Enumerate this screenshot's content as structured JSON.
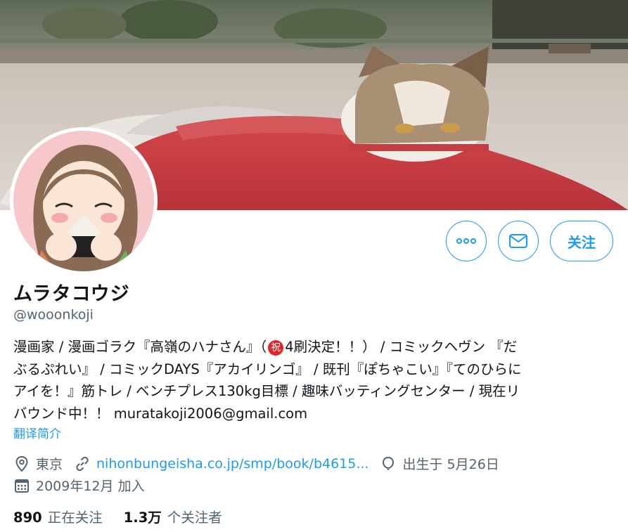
{
  "profile": {
    "name": "ムラタコウジ",
    "handle": "@wooonkoji",
    "bio_lines": [
      "漫画家 / 漫画ゴラク『高嶺のハナさん』（",
      "4刷決定！！） / コミックヘヴン 『だ",
      "ぶるぷれい』 / コミックDAYS『アカイリンゴ』 / 既刊『ぽちゃこい』『てのひらに",
      "アイを！』筋トレ / ベンチプレス130kg目標 / 趣味バッティングセンター / 現在リ",
      "バウンド中！！ muratakoji2006@gmail.com"
    ],
    "bio_emoji": "祝",
    "translate_label": "翻译简介",
    "location": "東京",
    "website": "nihonbungeisha.co.jp/smp/book/b4615...",
    "birthday": "出生于 5月26日",
    "joined": "2009年12月 加入"
  },
  "actions": {
    "more_icon": "more-icon",
    "message_icon": "mail-icon",
    "follow_label": "关注"
  },
  "stats": {
    "following_count": "890",
    "following_label": "正在关注",
    "followers_count": "1.3万",
    "followers_label": "个关注者"
  },
  "colors": {
    "accent": "#1d9bf0",
    "text": "#0f1419",
    "secondary": "#536471"
  }
}
